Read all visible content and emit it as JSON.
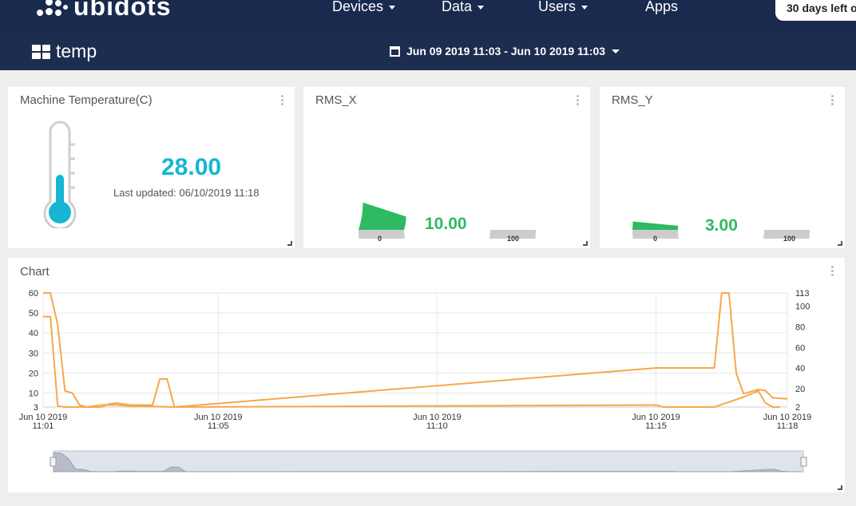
{
  "nav": {
    "logo_text": "ubidots",
    "items": [
      {
        "label": "Devices",
        "has_caret": true
      },
      {
        "label": "Data",
        "has_caret": true
      },
      {
        "label": "Users",
        "has_caret": true
      },
      {
        "label": "Apps",
        "has_caret": false
      }
    ],
    "trial_badge": "30 days left o"
  },
  "dashboard": {
    "name": "temp",
    "date_range": "Jun 09 2019 11:03 - Jun 10 2019 11:03"
  },
  "widgets": {
    "temperature": {
      "title": "Machine Temperature(C)",
      "value": "28.00",
      "updated": "Last updated: 06/10/2019 11:18",
      "accent": "#17b5d3"
    },
    "rms_x": {
      "title": "RMS_X",
      "value": "10.00",
      "min": "0",
      "max": "100",
      "fraction": 0.1
    },
    "rms_y": {
      "title": "RMS_Y",
      "value": "3.00",
      "min": "0",
      "max": "100",
      "fraction": 0.03
    }
  },
  "chart_data": {
    "type": "line",
    "title": "Chart",
    "x_ticks": [
      {
        "line1": "Jun 10 2019",
        "line2": "11:01"
      },
      {
        "line1": "Jun 10 2019",
        "line2": "11:05"
      },
      {
        "line1": "Jun 10 2019",
        "line2": "11:10"
      },
      {
        "line1": "Jun 10 2019",
        "line2": "11:15"
      },
      {
        "line1": "Jun 10 2019",
        "line2": "11:18"
      }
    ],
    "y_left_ticks": [
      "60",
      "50",
      "40",
      "30",
      "20",
      "10",
      "3"
    ],
    "y_right_ticks": [
      "113",
      "100",
      "80",
      "60",
      "40",
      "20",
      "2"
    ],
    "ylim_left": [
      3,
      60
    ],
    "ylim_right": [
      2,
      113
    ],
    "xlim": [
      "Jun 10 2019 11:01",
      "Jun 10 2019 11:18"
    ],
    "grid": true,
    "series": [
      {
        "axis": "left",
        "color": "#f5a84a",
        "points": [
          [
            "11:01:00",
            60
          ],
          [
            "11:01:10",
            60
          ],
          [
            "11:01:20",
            44
          ],
          [
            "11:01:30",
            11
          ],
          [
            "11:01:40",
            10
          ],
          [
            "11:01:50",
            4
          ],
          [
            "11:02:00",
            3
          ],
          [
            "11:02:20",
            3
          ],
          [
            "11:02:30",
            4.5
          ],
          [
            "11:02:40",
            5
          ],
          [
            "11:03:00",
            4
          ],
          [
            "11:03:30",
            4
          ],
          [
            "11:03:40",
            17
          ],
          [
            "11:03:50",
            17
          ],
          [
            "11:04:00",
            3
          ],
          [
            "11:15:00",
            4
          ],
          [
            "11:15:10",
            3
          ],
          [
            "11:16:10",
            3
          ],
          [
            "11:16:20",
            3
          ],
          [
            "11:17:00",
            8
          ],
          [
            "11:17:20",
            11
          ],
          [
            "11:17:30",
            5
          ],
          [
            "11:17:40",
            3
          ],
          [
            "11:17:50",
            3
          ]
        ]
      },
      {
        "axis": "right",
        "color": "#f5a84a",
        "points": [
          [
            "11:01:00",
            90
          ],
          [
            "11:01:10",
            90
          ],
          [
            "11:01:20",
            3
          ],
          [
            "11:01:30",
            2
          ],
          [
            "11:02:00",
            2
          ],
          [
            "11:02:20",
            4
          ],
          [
            "11:02:40",
            4
          ],
          [
            "11:03:00",
            3
          ],
          [
            "11:04:00",
            2
          ],
          [
            "11:15:00",
            40
          ],
          [
            "11:15:20",
            40
          ],
          [
            "11:15:40",
            40
          ],
          [
            "11:16:00",
            40
          ],
          [
            "11:16:20",
            40
          ],
          [
            "11:16:30",
            113
          ],
          [
            "11:16:40",
            113
          ],
          [
            "11:16:50",
            35
          ],
          [
            "11:17:00",
            15
          ],
          [
            "11:17:20",
            19
          ],
          [
            "11:17:30",
            18
          ],
          [
            "11:17:40",
            11
          ],
          [
            "11:18:00",
            10
          ]
        ]
      }
    ]
  }
}
